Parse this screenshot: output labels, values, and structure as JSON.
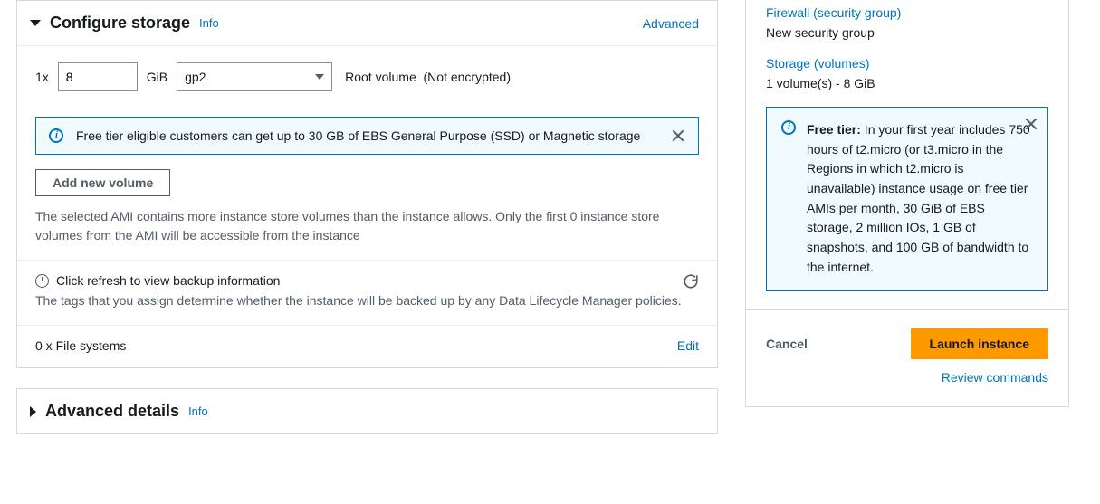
{
  "storage": {
    "title": "Configure storage",
    "info": "Info",
    "advanced": "Advanced",
    "multiplier": "1x",
    "size": "8",
    "unit": "GiB",
    "type": "gp2",
    "root_label": "Root volume",
    "encryption": "(Not encrypted)",
    "free_tier_inline": "Free tier eligible customers can get up to 30 GB of EBS General Purpose (SSD) or Magnetic storage",
    "add_volume": "Add new volume",
    "ami_note": "The selected AMI contains more instance store volumes than the instance allows. Only the first 0 instance store volumes from the AMI will be accessible from the instance",
    "refresh_title": "Click refresh to view backup information",
    "backup_note": "The tags that you assign determine whether the instance will be backed up by any Data Lifecycle Manager policies.",
    "fs_count": "0 x File systems",
    "edit": "Edit"
  },
  "advanced_details": {
    "title": "Advanced details",
    "info": "Info"
  },
  "summary": {
    "firewall_link": "Firewall (security group)",
    "firewall_val": "New security group",
    "storage_link": "Storage (volumes)",
    "storage_val": "1 volume(s) - 8 GiB",
    "free_tier_label": "Free tier:",
    "free_tier_body": " In your first year includes 750 hours of t2.micro (or t3.micro in the Regions in which t2.micro is unavailable) instance usage on free tier AMIs per month, 30 GiB of EBS storage, 2 million IOs, 1 GB of snapshots, and 100 GB of bandwidth to the internet.",
    "cancel": "Cancel",
    "launch": "Launch instance",
    "review": "Review commands"
  }
}
